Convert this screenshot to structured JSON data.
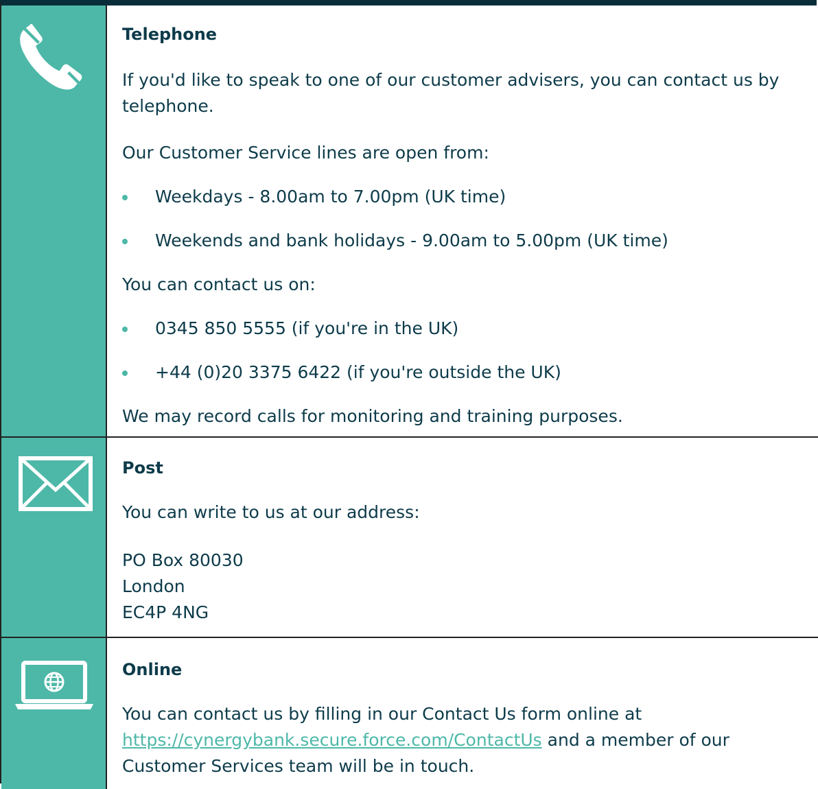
{
  "telephone": {
    "icon": "phone-icon",
    "heading": "Telephone",
    "intro": "If you'd like to speak to one of our customer advisers, you can contact us by telephone.",
    "hours_intro": "Our Customer Service lines are open from:",
    "hours": [
      "Weekdays - 8.00am to 7.00pm (UK time)",
      "Weekends and bank holidays - 9.00am to 5.00pm (UK time)"
    ],
    "numbers_intro": "You can contact us on:",
    "numbers": [
      "0345 850 5555 (if you're in the UK)",
      "+44 (0)20 3375 6422 (if you're outside the UK)"
    ],
    "note": "We may record calls for monitoring and training purposes."
  },
  "post": {
    "icon": "envelope-icon",
    "heading": "Post",
    "intro": "You can write to us at our address:",
    "address": [
      "PO Box 80030",
      "London",
      "EC4P 4NG"
    ]
  },
  "online": {
    "icon": "laptop-globe-icon",
    "heading": "Online",
    "text_before": "You can contact us by filling in our Contact Us form online at",
    "link": "https://cynergybank.secure.force.com/ContactUs",
    "text_after": "and a member of our Customer Services team will be in touch."
  },
  "colors": {
    "accent": "#4db8a8",
    "text": "#0d3b4a",
    "border": "#222222"
  }
}
